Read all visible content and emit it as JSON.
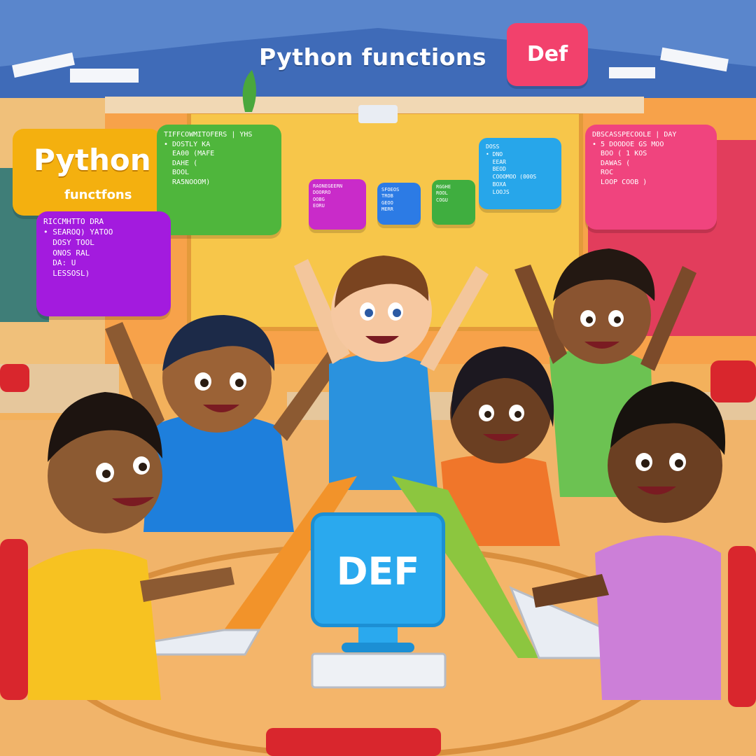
{
  "scene": {
    "title": "Python functions",
    "def_badge": "Def",
    "python_bubble": {
      "title": "Python",
      "subtitle": "functfons"
    },
    "monitor_text": "DEF",
    "code_bubbles": [
      {
        "name": "green-code-bubble",
        "color": "#4fb63c",
        "text": "TIFFCOWMITOFERS | YHS\n• DOSTLY KA\n  EA00 (MAFE\n  DAHE (\n  BOOL\n  RA5NOOOM)"
      },
      {
        "name": "purple-code-bubble",
        "color": "#a31bde",
        "text": "RICCMHTTO DRA\n• SEAROQ) YATOO\n  DOSY TOOL\n  ONOS RAL\n  DA: U\n  LESSOSL)"
      },
      {
        "name": "magenta-small-bubble",
        "color": "#c92bc9",
        "text": "RAONEGEERN\nDOORRO\nOOBG\nEORU"
      },
      {
        "name": "blue-small-bubble",
        "color": "#2c7be5",
        "text": "SFOEOS\nTROB\nGEOO\nMERR"
      },
      {
        "name": "green-small-bubble",
        "color": "#3fae3f",
        "text": "RGGHE\nROOL\nCOGU"
      },
      {
        "name": "cyan-code-bubble",
        "color": "#27a6ea",
        "text": "DOSS\n• DNO\n  EEAR\n  BEOD\n  COOOMOO (000S\n  BOXA\n  LOOJS"
      },
      {
        "name": "pink-code-bubble",
        "color": "#f0447e",
        "text": "DBSCASSPECOOLE | DAY\n• 5 DOODOE GS MOO\n  BOO ( 1 KOS\n  DAWAS (\n  ROC\n  LOOP COOB )"
      }
    ],
    "colors": {
      "ceiling": "#3f6bb8",
      "wall": "#f7a24a",
      "whiteboard": "#f7c64a",
      "table": "#f4b56a",
      "chairs": "#d9262d"
    }
  }
}
